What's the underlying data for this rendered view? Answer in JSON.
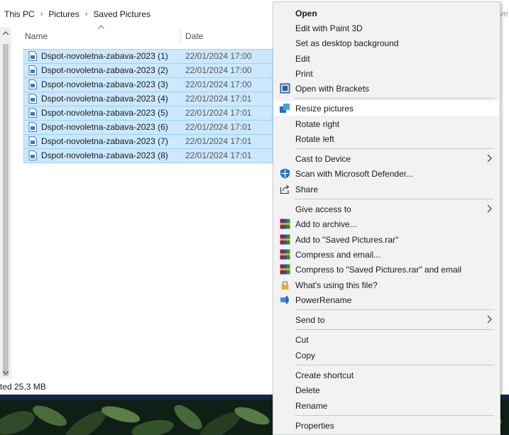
{
  "breadcrumb": {
    "items": [
      "This PC",
      "Pictures",
      "Saved Pictures"
    ],
    "sep_glyph": "›",
    "edge_text": "ve"
  },
  "columns": {
    "name": "Name",
    "date": "Date"
  },
  "files": [
    {
      "name": "Dspot-novoletna-zabava-2023 (1)",
      "date": "22/01/2024 17:00"
    },
    {
      "name": "Dspot-novoletna-zabava-2023 (2)",
      "date": "22/01/2024 17:00"
    },
    {
      "name": "Dspot-novoletna-zabava-2023 (3)",
      "date": "22/01/2024 17:00"
    },
    {
      "name": "Dspot-novoletna-zabava-2023 (4)",
      "date": "22/01/2024 17:01"
    },
    {
      "name": "Dspot-novoletna-zabava-2023 (5)",
      "date": "22/01/2024 17:01"
    },
    {
      "name": "Dspot-novoletna-zabava-2023 (6)",
      "date": "22/01/2024 17:01"
    },
    {
      "name": "Dspot-novoletna-zabava-2023 (7)",
      "date": "22/01/2024 17:01"
    },
    {
      "name": "Dspot-novoletna-zabava-2023 (8)",
      "date": "22/01/2024 17:01"
    }
  ],
  "status": {
    "selected_text": "ted  25,3 MB"
  },
  "menu": {
    "open": "Open",
    "edit_paint3d": "Edit with Paint 3D",
    "set_background": "Set as desktop background",
    "edit": "Edit",
    "print": "Print",
    "open_brackets": "Open with Brackets",
    "resize": "Resize pictures",
    "rotate_right": "Rotate right",
    "rotate_left": "Rotate left",
    "cast": "Cast to Device",
    "scan": "Scan with Microsoft Defender...",
    "share": "Share",
    "give_access": "Give access to",
    "add_archive": "Add to archive...",
    "add_rar": "Add to \"Saved Pictures.rar\"",
    "compress_email": "Compress and email...",
    "compress_rar_email": "Compress to \"Saved Pictures.rar\" and email",
    "whats_using": "What's using this file?",
    "powerrename": "PowerRename",
    "send_to": "Send to",
    "cut": "Cut",
    "copy": "Copy",
    "create_shortcut": "Create shortcut",
    "delete": "Delete",
    "rename": "Rename",
    "properties": "Properties"
  },
  "colors": {
    "selection_fill": "#cce8ff",
    "selection_border": "#99d1ff",
    "menu_bg": "#f2f2f2",
    "menu_hover": "#ffffff"
  }
}
